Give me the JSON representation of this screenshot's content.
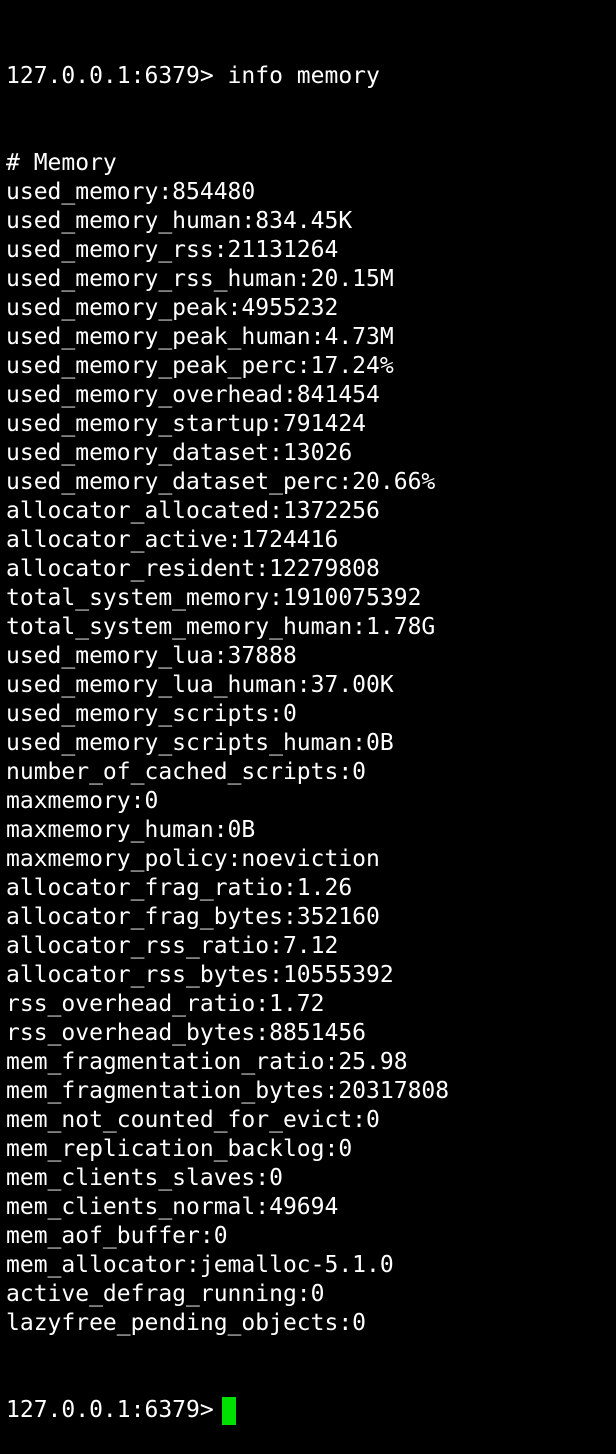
{
  "terminal": {
    "command_line": "127.0.0.1:6379> info memory",
    "lines": [
      "# Memory",
      "used_memory:854480",
      "used_memory_human:834.45K",
      "used_memory_rss:21131264",
      "used_memory_rss_human:20.15M",
      "used_memory_peak:4955232",
      "used_memory_peak_human:4.73M",
      "used_memory_peak_perc:17.24%",
      "used_memory_overhead:841454",
      "used_memory_startup:791424",
      "used_memory_dataset:13026",
      "used_memory_dataset_perc:20.66%",
      "allocator_allocated:1372256",
      "allocator_active:1724416",
      "allocator_resident:12279808",
      "total_system_memory:1910075392",
      "total_system_memory_human:1.78G",
      "used_memory_lua:37888",
      "used_memory_lua_human:37.00K",
      "used_memory_scripts:0",
      "used_memory_scripts_human:0B",
      "number_of_cached_scripts:0",
      "maxmemory:0",
      "maxmemory_human:0B",
      "maxmemory_policy:noeviction",
      "allocator_frag_ratio:1.26",
      "allocator_frag_bytes:352160",
      "allocator_rss_ratio:7.12",
      "allocator_rss_bytes:10555392",
      "rss_overhead_ratio:1.72",
      "rss_overhead_bytes:8851456",
      "mem_fragmentation_ratio:25.98",
      "mem_fragmentation_bytes:20317808",
      "mem_not_counted_for_evict:0",
      "mem_replication_backlog:0",
      "mem_clients_slaves:0",
      "mem_clients_normal:49694",
      "mem_aof_buffer:0",
      "mem_allocator:jemalloc-5.1.0",
      "active_defrag_running:0",
      "lazyfree_pending_objects:0"
    ],
    "prompt": "127.0.0.1:6379>",
    "cursor_color": "#00e000",
    "background_color": "#000000",
    "text_color": "#ffffff"
  }
}
